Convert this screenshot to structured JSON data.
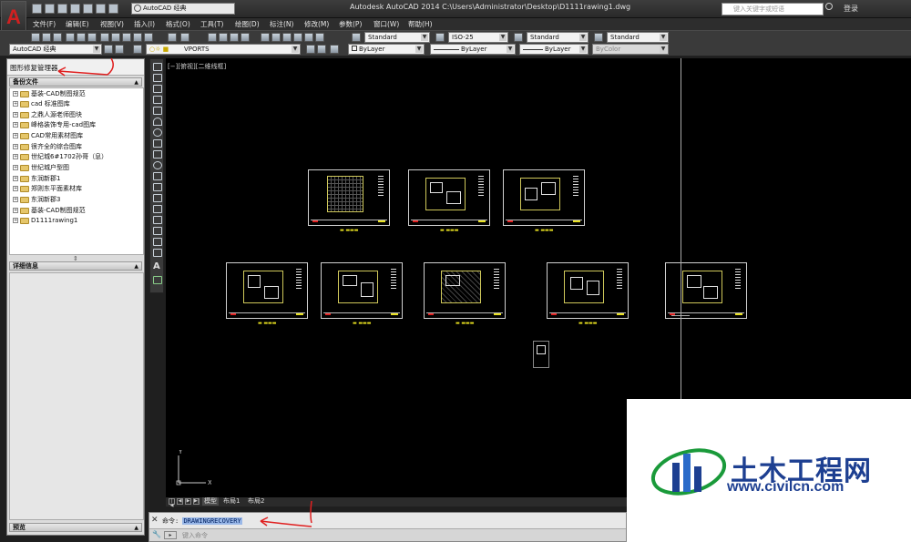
{
  "app": {
    "logo": "A",
    "title": "Autodesk AutoCAD 2014    C:\\Users\\Administrator\\Desktop\\D1111rawing1.dwg",
    "workspace": "AutoCAD 经典",
    "search_placeholder": "键入关键字或短语",
    "login": "登录"
  },
  "menu": [
    "文件(F)",
    "编辑(E)",
    "视图(V)",
    "插入(I)",
    "格式(O)",
    "工具(T)",
    "绘图(D)",
    "标注(N)",
    "修改(M)",
    "参数(P)",
    "窗口(W)",
    "帮助(H)"
  ],
  "toolbar": {
    "text_style": "Standard",
    "dim_style": "ISO-25",
    "table_style": "Standard",
    "multileader_style": "Standard",
    "workspace": "AutoCAD 经典",
    "layer": "VPORTS",
    "color": "ByLayer",
    "linetype": "ByLayer",
    "lineweight": "ByLayer",
    "plotstyle": "ByColor"
  },
  "palette": {
    "title": "图形修复管理器",
    "backup_header": "备份文件",
    "backup_files": [
      "基装-CAD制图规范",
      "cad 标准图库",
      "之鼎人源老师图块",
      "峰格装饰专用-cad图库",
      "CAD常用素材图库",
      "很齐全的综合图库",
      "世纪城6#1702孙哥（息）",
      "世纪城户型图",
      "东润新郡1",
      "郑则东平面素材库",
      "东润新郡3",
      "基装-CAD制图规范",
      "D1111rawing1"
    ],
    "details_header": "详细信息",
    "preview_header": "预览"
  },
  "viewport_label": "[−][俯视][二维线框]",
  "layout_tabs": [
    "模型",
    "布局1",
    "布局2"
  ],
  "command": {
    "history_prefix": "命令:",
    "history_command": "DRAWINGRECOVERY",
    "input_placeholder": "键入命令"
  },
  "watermark": {
    "text": "土木工程网",
    "url": "www.civilcn.com"
  },
  "colors": {
    "drawing_bg": "#000000",
    "ui_dark": "#3a3a3a",
    "annotation_red": "#e02020",
    "watermark_blue": "#1d3f91"
  }
}
